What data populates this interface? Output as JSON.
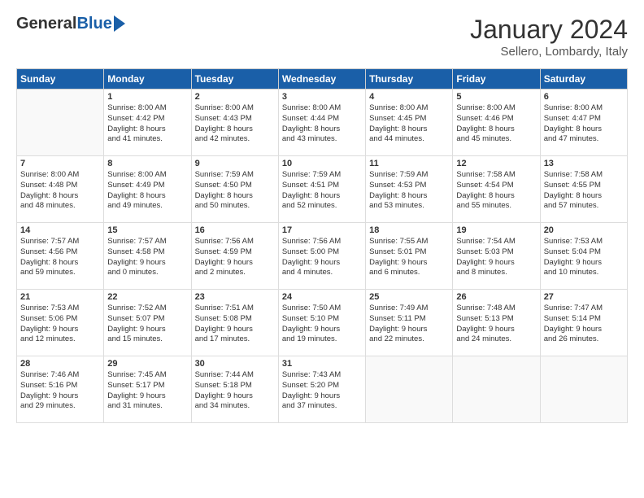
{
  "header": {
    "logo_general": "General",
    "logo_blue": "Blue",
    "month_title": "January 2024",
    "location": "Sellero, Lombardy, Italy"
  },
  "weekdays": [
    "Sunday",
    "Monday",
    "Tuesday",
    "Wednesday",
    "Thursday",
    "Friday",
    "Saturday"
  ],
  "weeks": [
    [
      {
        "day": "",
        "info": ""
      },
      {
        "day": "1",
        "info": "Sunrise: 8:00 AM\nSunset: 4:42 PM\nDaylight: 8 hours\nand 41 minutes."
      },
      {
        "day": "2",
        "info": "Sunrise: 8:00 AM\nSunset: 4:43 PM\nDaylight: 8 hours\nand 42 minutes."
      },
      {
        "day": "3",
        "info": "Sunrise: 8:00 AM\nSunset: 4:44 PM\nDaylight: 8 hours\nand 43 minutes."
      },
      {
        "day": "4",
        "info": "Sunrise: 8:00 AM\nSunset: 4:45 PM\nDaylight: 8 hours\nand 44 minutes."
      },
      {
        "day": "5",
        "info": "Sunrise: 8:00 AM\nSunset: 4:46 PM\nDaylight: 8 hours\nand 45 minutes."
      },
      {
        "day": "6",
        "info": "Sunrise: 8:00 AM\nSunset: 4:47 PM\nDaylight: 8 hours\nand 47 minutes."
      }
    ],
    [
      {
        "day": "7",
        "info": "Sunrise: 8:00 AM\nSunset: 4:48 PM\nDaylight: 8 hours\nand 48 minutes."
      },
      {
        "day": "8",
        "info": "Sunrise: 8:00 AM\nSunset: 4:49 PM\nDaylight: 8 hours\nand 49 minutes."
      },
      {
        "day": "9",
        "info": "Sunrise: 7:59 AM\nSunset: 4:50 PM\nDaylight: 8 hours\nand 50 minutes."
      },
      {
        "day": "10",
        "info": "Sunrise: 7:59 AM\nSunset: 4:51 PM\nDaylight: 8 hours\nand 52 minutes."
      },
      {
        "day": "11",
        "info": "Sunrise: 7:59 AM\nSunset: 4:53 PM\nDaylight: 8 hours\nand 53 minutes."
      },
      {
        "day": "12",
        "info": "Sunrise: 7:58 AM\nSunset: 4:54 PM\nDaylight: 8 hours\nand 55 minutes."
      },
      {
        "day": "13",
        "info": "Sunrise: 7:58 AM\nSunset: 4:55 PM\nDaylight: 8 hours\nand 57 minutes."
      }
    ],
    [
      {
        "day": "14",
        "info": "Sunrise: 7:57 AM\nSunset: 4:56 PM\nDaylight: 8 hours\nand 59 minutes."
      },
      {
        "day": "15",
        "info": "Sunrise: 7:57 AM\nSunset: 4:58 PM\nDaylight: 9 hours\nand 0 minutes."
      },
      {
        "day": "16",
        "info": "Sunrise: 7:56 AM\nSunset: 4:59 PM\nDaylight: 9 hours\nand 2 minutes."
      },
      {
        "day": "17",
        "info": "Sunrise: 7:56 AM\nSunset: 5:00 PM\nDaylight: 9 hours\nand 4 minutes."
      },
      {
        "day": "18",
        "info": "Sunrise: 7:55 AM\nSunset: 5:01 PM\nDaylight: 9 hours\nand 6 minutes."
      },
      {
        "day": "19",
        "info": "Sunrise: 7:54 AM\nSunset: 5:03 PM\nDaylight: 9 hours\nand 8 minutes."
      },
      {
        "day": "20",
        "info": "Sunrise: 7:53 AM\nSunset: 5:04 PM\nDaylight: 9 hours\nand 10 minutes."
      }
    ],
    [
      {
        "day": "21",
        "info": "Sunrise: 7:53 AM\nSunset: 5:06 PM\nDaylight: 9 hours\nand 12 minutes."
      },
      {
        "day": "22",
        "info": "Sunrise: 7:52 AM\nSunset: 5:07 PM\nDaylight: 9 hours\nand 15 minutes."
      },
      {
        "day": "23",
        "info": "Sunrise: 7:51 AM\nSunset: 5:08 PM\nDaylight: 9 hours\nand 17 minutes."
      },
      {
        "day": "24",
        "info": "Sunrise: 7:50 AM\nSunset: 5:10 PM\nDaylight: 9 hours\nand 19 minutes."
      },
      {
        "day": "25",
        "info": "Sunrise: 7:49 AM\nSunset: 5:11 PM\nDaylight: 9 hours\nand 22 minutes."
      },
      {
        "day": "26",
        "info": "Sunrise: 7:48 AM\nSunset: 5:13 PM\nDaylight: 9 hours\nand 24 minutes."
      },
      {
        "day": "27",
        "info": "Sunrise: 7:47 AM\nSunset: 5:14 PM\nDaylight: 9 hours\nand 26 minutes."
      }
    ],
    [
      {
        "day": "28",
        "info": "Sunrise: 7:46 AM\nSunset: 5:16 PM\nDaylight: 9 hours\nand 29 minutes."
      },
      {
        "day": "29",
        "info": "Sunrise: 7:45 AM\nSunset: 5:17 PM\nDaylight: 9 hours\nand 31 minutes."
      },
      {
        "day": "30",
        "info": "Sunrise: 7:44 AM\nSunset: 5:18 PM\nDaylight: 9 hours\nand 34 minutes."
      },
      {
        "day": "31",
        "info": "Sunrise: 7:43 AM\nSunset: 5:20 PM\nDaylight: 9 hours\nand 37 minutes."
      },
      {
        "day": "",
        "info": ""
      },
      {
        "day": "",
        "info": ""
      },
      {
        "day": "",
        "info": ""
      }
    ]
  ]
}
